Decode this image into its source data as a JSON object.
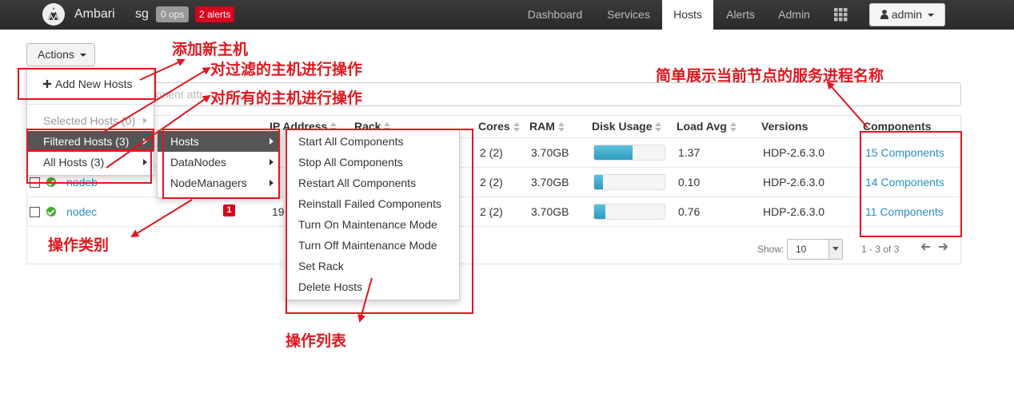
{
  "navbar": {
    "brand": "Ambari",
    "cluster": "sg",
    "ops_badge": "0 ops",
    "alerts_badge": "2 alerts",
    "links": [
      "Dashboard",
      "Services",
      "Hosts",
      "Alerts",
      "Admin"
    ],
    "active_link": "Hosts",
    "user": "admin"
  },
  "actions": {
    "label": "Actions",
    "add_new_hosts": "Add New Hosts",
    "selected_hosts": "Selected Hosts (0)",
    "filtered_hosts": "Filtered Hosts (3)",
    "all_hosts": "All Hosts (3)"
  },
  "submenu_categories": [
    "Hosts",
    "DataNodes",
    "NodeManagers"
  ],
  "operations": [
    "Start All Components",
    "Stop All Components",
    "Restart All Components",
    "Reinstall Failed Components",
    "Turn On Maintenance Mode",
    "Turn Off Maintenance Mode",
    "Set Rack",
    "Delete Hosts"
  ],
  "filter": {
    "placeholder": "ponent attr"
  },
  "table": {
    "headers": {
      "ip": "IP Address",
      "rack": "Rack",
      "cores": "Cores",
      "ram": "RAM",
      "disk": "Disk Usage",
      "load": "Load Avg",
      "versions": "Versions",
      "components": "Components"
    },
    "rows": [
      {
        "name": "",
        "ip": "",
        "alerts": "",
        "cores": "2 (2)",
        "ram": "3.70GB",
        "disk_pct": 55,
        "load": "1.37",
        "version": "HDP-2.6.3.0",
        "components": "15 Components"
      },
      {
        "name": "nodeb",
        "ip": "",
        "alerts": "",
        "cores": "2 (2)",
        "ram": "3.70GB",
        "disk_pct": 12,
        "load": "0.10",
        "version": "HDP-2.6.3.0",
        "components": "14 Components"
      },
      {
        "name": "nodec",
        "ip": "19",
        "alerts": "1",
        "cores": "2 (2)",
        "ram": "3.70GB",
        "disk_pct": 16,
        "load": "0.76",
        "version": "HDP-2.6.3.0",
        "components": "11 Components"
      }
    ]
  },
  "pagination": {
    "show_label": "Show:",
    "page_size": "10",
    "info": "1 - 3 of 3"
  },
  "annotations": {
    "add_new_host": "添加新主机",
    "filtered_ops": "对过滤的主机进行操作",
    "all_ops": "对所有的主机进行操作",
    "components_note": "简单展示当前节点的服务进程名称",
    "category": "操作类别",
    "op_list": "操作列表"
  },
  "colors": {
    "navbar": "#2f2f2f",
    "annotation": "#e0171f",
    "link": "#2a8fc7",
    "alert_badge": "#d9001d"
  }
}
